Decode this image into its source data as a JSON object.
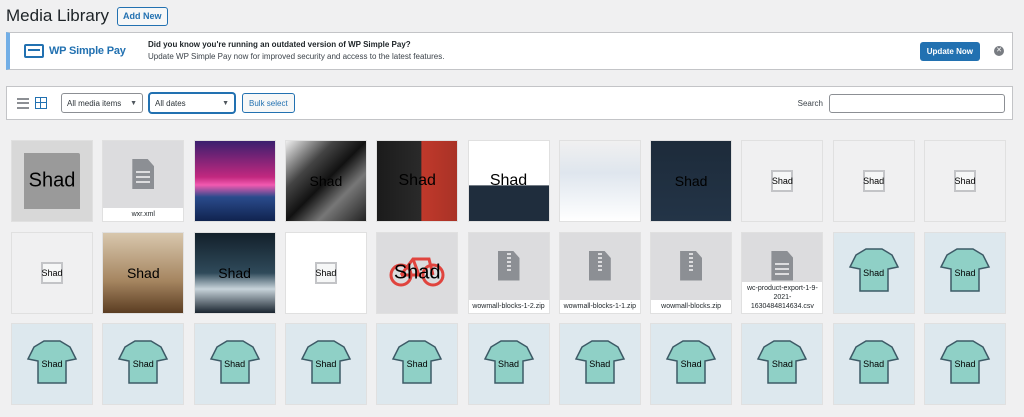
{
  "header": {
    "title": "Media Library",
    "add_new": "Add New"
  },
  "notice": {
    "brand": "WP Simple Pay",
    "heading": "Did you know you're running an outdated version of WP Simple Pay?",
    "body": "Update WP Simple Pay now for improved security and access to the latest features.",
    "button": "Update Now",
    "dismiss": "✕"
  },
  "toolbar": {
    "type_filter": "All media items",
    "date_filter": "All dates",
    "bulk_select": "Bulk select",
    "search_label": "Search",
    "search_value": ""
  },
  "thumb_text": "Shad",
  "tiles": [
    {
      "kind": "placeholder",
      "bg": "#d8d8d8",
      "fs": "20px",
      "shad": true,
      "fname": ""
    },
    {
      "kind": "doc",
      "bg": "#dcdcde",
      "fs": "0px",
      "shad": false,
      "fname": "wxr.xml"
    },
    {
      "kind": "photo",
      "bg": "linear-gradient(180deg,#3a1f6e 0%,#c2287f 45%,#f25ab0 55%,#2a4b8c 70%,#10234f 100%)",
      "fs": "0px",
      "shad": false,
      "fname": ""
    },
    {
      "kind": "photo",
      "bg": "linear-gradient(135deg,#eee 0%,#444 30%,#111 50%,#777 70%,#222 100%)",
      "fs": "14px",
      "shad": true,
      "fname": ""
    },
    {
      "kind": "photo",
      "bg": "linear-gradient(90deg,#1b1b1b 0%,#2a2a2a 55%,#c0392b 56%,#a93226 100%)",
      "fs": "16px",
      "shad": true,
      "fname": ""
    },
    {
      "kind": "photo",
      "bg": "linear-gradient(180deg,#ffffff 0%,#ffffff 55%,#1f2d3d 56%,#1f2d3d 100%)",
      "fs": "16px",
      "shad": true,
      "fname": ""
    },
    {
      "kind": "photo",
      "bg": "linear-gradient(180deg,#f0f0f0 0%,#dfe6ee 40%,#ffffff 100%)",
      "fs": "0px",
      "shad": false,
      "fname": ""
    },
    {
      "kind": "photo",
      "bg": "linear-gradient(180deg,#1d2b3a 0%,#233447 100%)",
      "fs": "14px",
      "shad": true,
      "fname": ""
    },
    {
      "kind": "placeholder",
      "bg": "#f0f0f1",
      "fs": "9px",
      "shad": true,
      "fname": ""
    },
    {
      "kind": "placeholder",
      "bg": "#f0f0f1",
      "fs": "9px",
      "shad": true,
      "fname": ""
    },
    {
      "kind": "placeholder",
      "bg": "#f0f0f1",
      "fs": "9px",
      "shad": true,
      "fname": ""
    },
    {
      "kind": "placeholder",
      "bg": "#f0f0f1",
      "fs": "9px",
      "shad": true,
      "fname": ""
    },
    {
      "kind": "photo",
      "bg": "linear-gradient(180deg,#d8c7ad 0%,#a58560 60%,#5b3d22 100%)",
      "fs": "14px",
      "shad": true,
      "fname": ""
    },
    {
      "kind": "photo",
      "bg": "linear-gradient(180deg,#13202b 0%,#2f4a5a 50%,#c7d3da 70%,#1a2530 100%)",
      "fs": "14px",
      "shad": true,
      "fname": ""
    },
    {
      "kind": "placeholder",
      "bg": "#ffffff",
      "fs": "9px",
      "shad": true,
      "fname": ""
    },
    {
      "kind": "bike",
      "bg": "#dcdcde",
      "fs": "20px",
      "shad": true,
      "fname": ""
    },
    {
      "kind": "zip",
      "bg": "#dcdcde",
      "fs": "0px",
      "shad": false,
      "fname": "wowmall-blocks-1-2.zip"
    },
    {
      "kind": "zip",
      "bg": "#dcdcde",
      "fs": "0px",
      "shad": false,
      "fname": "wowmall-blocks-1-1.zip"
    },
    {
      "kind": "zip",
      "bg": "#dcdcde",
      "fs": "0px",
      "shad": false,
      "fname": "wowmall-blocks.zip"
    },
    {
      "kind": "doc",
      "bg": "#dcdcde",
      "fs": "0px",
      "shad": false,
      "fname": "wc-product-export-1-9-2021-1630484814634.csv"
    },
    {
      "kind": "product",
      "bg": "#dde8ee",
      "fs": "9px",
      "shad": true,
      "fname": ""
    },
    {
      "kind": "product",
      "bg": "#dde8ee",
      "fs": "9px",
      "shad": true,
      "fname": ""
    },
    {
      "kind": "product",
      "bg": "#dde8ee",
      "fs": "9px",
      "shad": true,
      "fname": ""
    },
    {
      "kind": "product",
      "bg": "#dde8ee",
      "fs": "9px",
      "shad": true,
      "fname": ""
    },
    {
      "kind": "product",
      "bg": "#dde8ee",
      "fs": "9px",
      "shad": true,
      "fname": ""
    },
    {
      "kind": "product",
      "bg": "#dde8ee",
      "fs": "9px",
      "shad": true,
      "fname": ""
    },
    {
      "kind": "product",
      "bg": "#dde8ee",
      "fs": "9px",
      "shad": true,
      "fname": ""
    },
    {
      "kind": "product",
      "bg": "#dde8ee",
      "fs": "9px",
      "shad": true,
      "fname": ""
    },
    {
      "kind": "product",
      "bg": "#dde8ee",
      "fs": "9px",
      "shad": true,
      "fname": ""
    },
    {
      "kind": "product",
      "bg": "#dde8ee",
      "fs": "9px",
      "shad": true,
      "fname": ""
    },
    {
      "kind": "product",
      "bg": "#dde8ee",
      "fs": "9px",
      "shad": true,
      "fname": ""
    },
    {
      "kind": "product",
      "bg": "#dde8ee",
      "fs": "9px",
      "shad": true,
      "fname": ""
    },
    {
      "kind": "product",
      "bg": "#dde8ee",
      "fs": "9px",
      "shad": true,
      "fname": ""
    }
  ]
}
